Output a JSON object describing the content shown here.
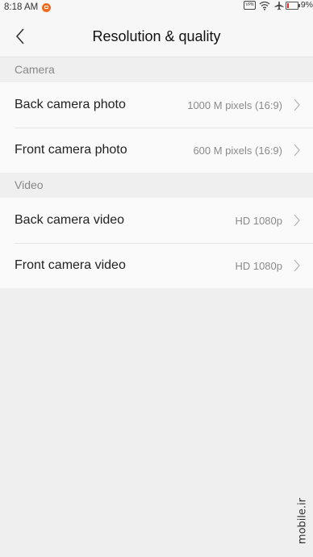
{
  "status_bar": {
    "time": "8:18 AM",
    "vpn_label": "VPN",
    "battery_percent": "9%",
    "icons": [
      "notification-icon",
      "vpn-icon",
      "wifi-icon",
      "airplane-icon",
      "battery-icon"
    ]
  },
  "header": {
    "title": "Resolution & quality",
    "back_icon": "chevron-left-icon"
  },
  "sections": [
    {
      "title": "Camera",
      "items": [
        {
          "label": "Back camera photo",
          "value": "1000 M pixels (16:9)"
        },
        {
          "label": "Front camera photo",
          "value": "600 M pixels (16:9)"
        }
      ]
    },
    {
      "title": "Video",
      "items": [
        {
          "label": "Back camera video",
          "value": "HD 1080p"
        },
        {
          "label": "Front camera video",
          "value": "HD 1080p"
        }
      ]
    }
  ],
  "watermark": "mobile.ir",
  "colors": {
    "background": "#efefef",
    "row_background": "#fafafa",
    "notification_accent": "#f26a1b",
    "battery_low": "#e02a2a"
  }
}
